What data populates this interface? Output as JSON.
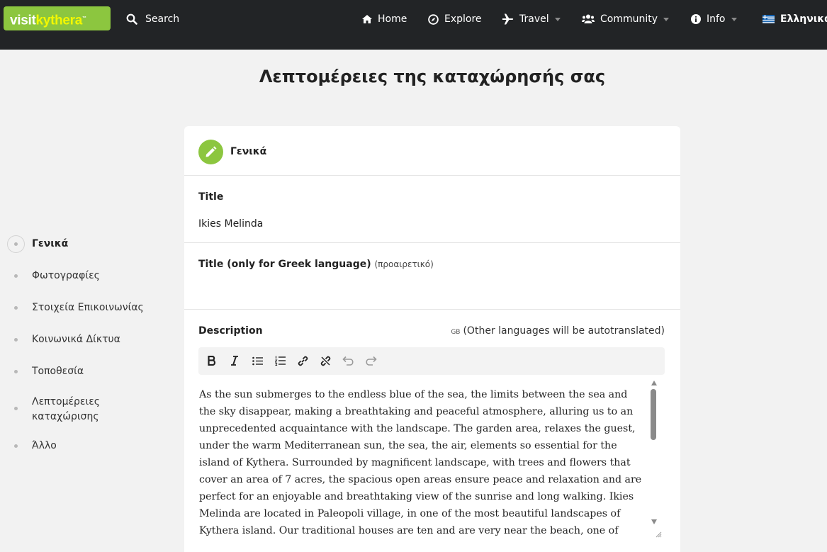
{
  "header": {
    "logo": {
      "part1": "visit",
      "part2": "kythera",
      "tm": "™"
    },
    "search_label": "Search",
    "nav": [
      {
        "label": "Home",
        "icon": "home-icon"
      },
      {
        "label": "Explore",
        "icon": "compass-icon"
      },
      {
        "label": "Travel",
        "icon": "plane-icon",
        "dropdown": true
      },
      {
        "label": "Community",
        "icon": "users-icon",
        "dropdown": true
      },
      {
        "label": "Info",
        "icon": "info-icon",
        "dropdown": true
      },
      {
        "label": "Ελληνικά",
        "icon": "greek-flag-icon"
      }
    ]
  },
  "page": {
    "title": "Λεπτομέρειες της καταχώρησής σας"
  },
  "sidebar": {
    "items": [
      {
        "label": "Γενικά",
        "active": true
      },
      {
        "label": "Φωτογραφίες"
      },
      {
        "label": "Στοιχεία Επικοινωνίας"
      },
      {
        "label": "Κοινωνικά Δίκτυα"
      },
      {
        "label": "Τοποθεσία"
      },
      {
        "label": "Λεπτομέρειες καταχώρισης"
      },
      {
        "label": "Άλλο"
      }
    ]
  },
  "card": {
    "section_title": "Γενικά",
    "title_label": "Title",
    "title_value": "Ikies Melinda",
    "greek_title_label": "Title (only for Greek language)",
    "greek_title_optional": "(προαιρετικό)",
    "greek_title_value": "",
    "description_label": "Description",
    "lang_code": "GB",
    "autotranslate_hint": "(Other languages will be autotranslated)",
    "toolbar": [
      "bold-icon",
      "italic-icon",
      "bullet-list-icon",
      "numbered-list-icon",
      "link-icon",
      "unlink-icon",
      "undo-icon",
      "redo-icon"
    ],
    "description_text": "As the sun submerges to the endless blue of the sea, the limits between the sea and the sky disappear, making a breathtaking and peaceful atmosphere, alluring us to an unprecedented acquaintance with the landscape. The garden area, relaxes the guest, under the warm Mediterranean sun, the sea, the air, elements so essential for the island of Kythera. Surrounded by magnificent landscape, with trees and flowers that cover an area of 7 acres, the spacious open areas ensure peace and relaxation and are perfect for an enjoyable and breathtaking view of the sunrise and long walking. Ikies Melinda are located in Paleopoli village, in one of the most beautiful landscapes of Kythera island. Our traditional houses are ten and are very near the beach, one of Paleopoli Beach"
  },
  "colors": {
    "accent": "#8cc63f",
    "header_bg": "#222426",
    "page_bg": "#f2f2f2"
  }
}
